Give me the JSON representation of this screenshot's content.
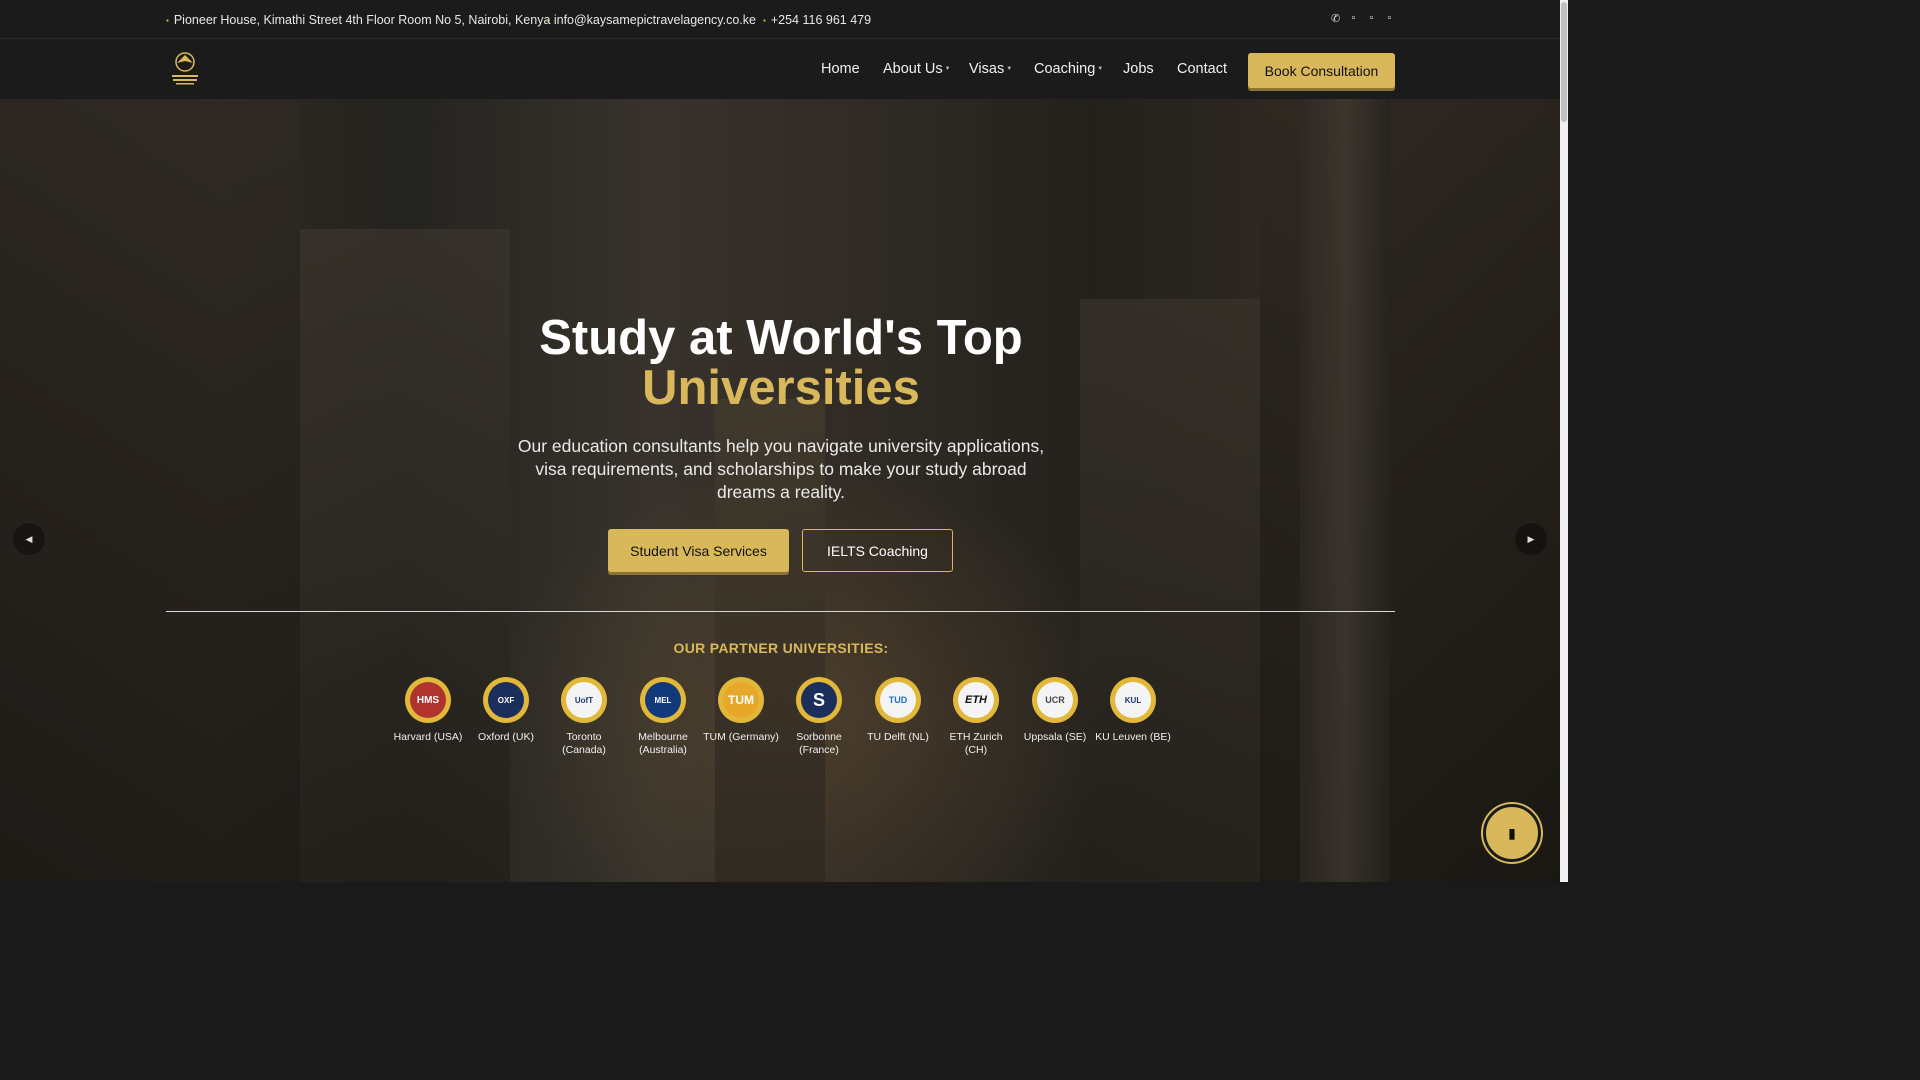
{
  "topbar": {
    "address": "Pioneer House, Kimathi Street 4th Floor Room No 5, Nairobi, Kenya",
    "email": "info@kaysamepictravelagency.co.ke",
    "phone": "+254 116 961 479",
    "social_icons": [
      "whatsapp-icon",
      "facebook-icon",
      "instagram-icon",
      "tiktok-icon"
    ]
  },
  "nav": {
    "logo_alt": "Kaysam Epic Travel Agency",
    "items": [
      "Home",
      "About Us",
      "Visas",
      "Coaching",
      "Jobs",
      "Contact"
    ],
    "cta": "Book Consultation"
  },
  "hero": {
    "title_line1": "Study at World's Top",
    "title_line2": "Universities",
    "subtitle": "Our education consultants help you navigate university applications, visa requirements, and scholarships to make your study abroad dreams a reality.",
    "primary_button": "Student Visa Services",
    "secondary_button": "IELTS Coaching"
  },
  "partners": {
    "title": "OUR PARTNER UNIVERSITIES:",
    "items": [
      {
        "name": "Harvard (USA)",
        "logo": "HMS"
      },
      {
        "name": "Oxford (UK)",
        "logo": "OXF"
      },
      {
        "name": "Toronto (Canada)",
        "logo": "UofT"
      },
      {
        "name": "Melbourne (Australia)",
        "logo": "MEL"
      },
      {
        "name": "TUM (Germany)",
        "logo": "TUM"
      },
      {
        "name": "Sorbonne (France)",
        "logo": "S"
      },
      {
        "name": "TU Delft (NL)",
        "logo": "TUD"
      },
      {
        "name": "ETH Zurich (CH)",
        "logo": "ETH"
      },
      {
        "name": "Uppsala (SE)",
        "logo": "UCR"
      },
      {
        "name": "KU Leuven (BE)",
        "logo": "KUL"
      }
    ]
  },
  "colors": {
    "accent": "#d9b85c",
    "dark": "#1b1b1b"
  }
}
